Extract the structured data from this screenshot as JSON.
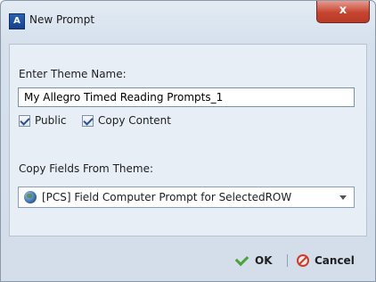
{
  "window": {
    "title": "New Prompt",
    "app_icon": "app-icon",
    "close_label": "x"
  },
  "form": {
    "theme_name_label": "Enter Theme Name:",
    "theme_name_value": "My Allegro Timed Reading Prompts_1",
    "public_label": "Public",
    "public_checked": true,
    "copy_content_label": "Copy Content",
    "copy_content_checked": true,
    "copy_fields_label": "Copy Fields From Theme:",
    "copy_fields_selected": "[PCS] Field Computer Prompt for SelectedROW",
    "copy_fields_icon": "globe-icon"
  },
  "footer": {
    "ok_label": "OK",
    "cancel_label": "Cancel"
  },
  "colors": {
    "accent": "#2c5f9c",
    "ok_check": "#4aa23a",
    "cancel_red": "#d23a2a",
    "close_red": "#c5442f"
  }
}
